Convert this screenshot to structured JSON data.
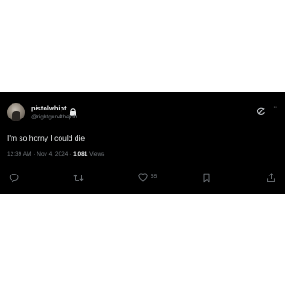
{
  "tweet": {
    "author": {
      "display_name": "pistolwhipt",
      "handle": "@rightgun4thejob",
      "protected_icon": "lock-icon"
    },
    "text": "I'm so horny I could die",
    "meta": {
      "time": "12:39 AM",
      "separator1": " · ",
      "date": "Nov 4, 2024",
      "separator2": " · ",
      "views_count": "1,081",
      "views_label": " Views"
    },
    "actions": {
      "reply": {
        "icon": "reply-icon",
        "count": ""
      },
      "retweet": {
        "icon": "retweet-icon",
        "count": ""
      },
      "like": {
        "icon": "heart-icon",
        "count": "55"
      },
      "bookmark": {
        "icon": "bookmark-icon"
      },
      "share": {
        "icon": "share-icon"
      }
    },
    "header_icons": {
      "grok": "grok-icon",
      "more": "more-icon",
      "more_glyph": "···"
    }
  },
  "colors": {
    "background": "#000000",
    "primary_text": "#e7e9ea",
    "secondary_text": "#71767b"
  }
}
